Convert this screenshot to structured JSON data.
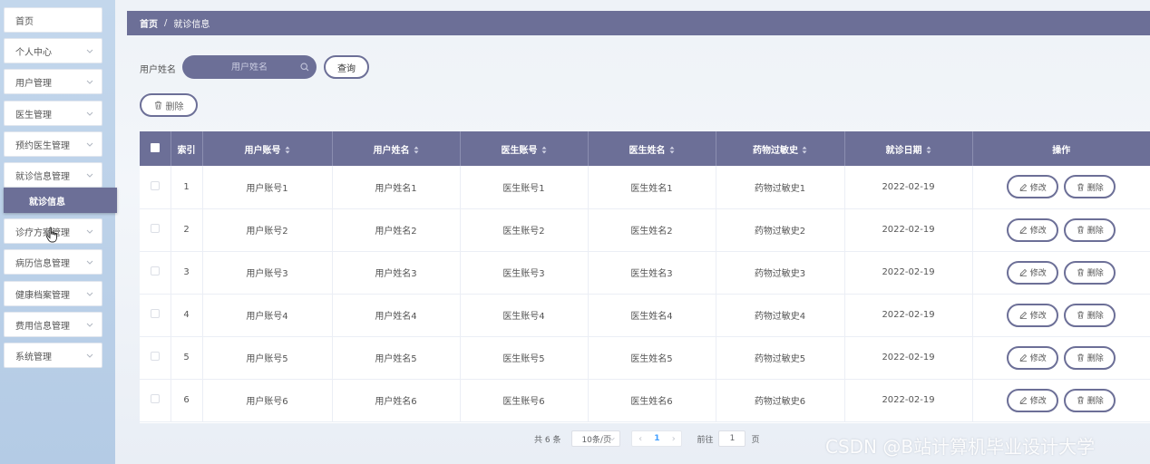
{
  "sidebar": {
    "items": [
      {
        "label": "首页",
        "has_arrow": false
      },
      {
        "label": "个人中心",
        "has_arrow": true
      },
      {
        "label": "用户管理",
        "has_arrow": true
      },
      {
        "label": "医生管理",
        "has_arrow": true
      },
      {
        "label": "预约医生管理",
        "has_arrow": true
      },
      {
        "label": "就诊信息管理",
        "has_arrow": true
      },
      {
        "label": "诊疗方案管理",
        "has_arrow": true
      },
      {
        "label": "病历信息管理",
        "has_arrow": true
      },
      {
        "label": "健康档案管理",
        "has_arrow": true
      },
      {
        "label": "费用信息管理",
        "has_arrow": true
      },
      {
        "label": "系统管理",
        "has_arrow": true
      }
    ],
    "active_sub": "就诊信息"
  },
  "breadcrumb": {
    "home": "首页",
    "separator": "/",
    "current": "就诊信息"
  },
  "search": {
    "label": "用户姓名",
    "placeholder": "用户姓名",
    "value": "",
    "button": "查询"
  },
  "toolbar": {
    "delete_label": "删除"
  },
  "table": {
    "columns": [
      "索引",
      "用户账号",
      "用户姓名",
      "医生账号",
      "医生姓名",
      "药物过敏史",
      "就诊日期",
      "操作"
    ],
    "sortable": [
      false,
      true,
      true,
      true,
      true,
      true,
      true,
      false
    ],
    "rows": [
      {
        "index": "1",
        "user_account": "用户账号1",
        "user_name": "用户姓名1",
        "doctor_account": "医生账号1",
        "doctor_name": "医生姓名1",
        "allergy": "药物过敏史1",
        "date": "2022-02-19"
      },
      {
        "index": "2",
        "user_account": "用户账号2",
        "user_name": "用户姓名2",
        "doctor_account": "医生账号2",
        "doctor_name": "医生姓名2",
        "allergy": "药物过敏史2",
        "date": "2022-02-19"
      },
      {
        "index": "3",
        "user_account": "用户账号3",
        "user_name": "用户姓名3",
        "doctor_account": "医生账号3",
        "doctor_name": "医生姓名3",
        "allergy": "药物过敏史3",
        "date": "2022-02-19"
      },
      {
        "index": "4",
        "user_account": "用户账号4",
        "user_name": "用户姓名4",
        "doctor_account": "医生账号4",
        "doctor_name": "医生姓名4",
        "allergy": "药物过敏史4",
        "date": "2022-02-19"
      },
      {
        "index": "5",
        "user_account": "用户账号5",
        "user_name": "用户姓名5",
        "doctor_account": "医生账号5",
        "doctor_name": "医生姓名5",
        "allergy": "药物过敏史5",
        "date": "2022-02-19"
      },
      {
        "index": "6",
        "user_account": "用户账号6",
        "user_name": "用户姓名6",
        "doctor_account": "医生账号6",
        "doctor_name": "医生姓名6",
        "allergy": "药物过敏史6",
        "date": "2022-02-19"
      }
    ],
    "edit_label": "修改",
    "delete_label": "删除"
  },
  "pagination": {
    "total": "共 6 条",
    "page_size": "10条/页",
    "current_page": "1",
    "goto_label": "前往",
    "goto_value": "1",
    "goto_suffix": "页"
  },
  "watermark": "CSDN @B站计算机毕业设计大学",
  "colors": {
    "primary": "#6c6f97",
    "sidebar_bg": "#c3d7ec",
    "page_link": "#409eff"
  },
  "icons": [
    "chevron-down-icon",
    "search-icon",
    "trash-icon",
    "edit-icon",
    "sort-icon",
    "checkbox-icon",
    "hand-pointer-cursor-icon"
  ]
}
